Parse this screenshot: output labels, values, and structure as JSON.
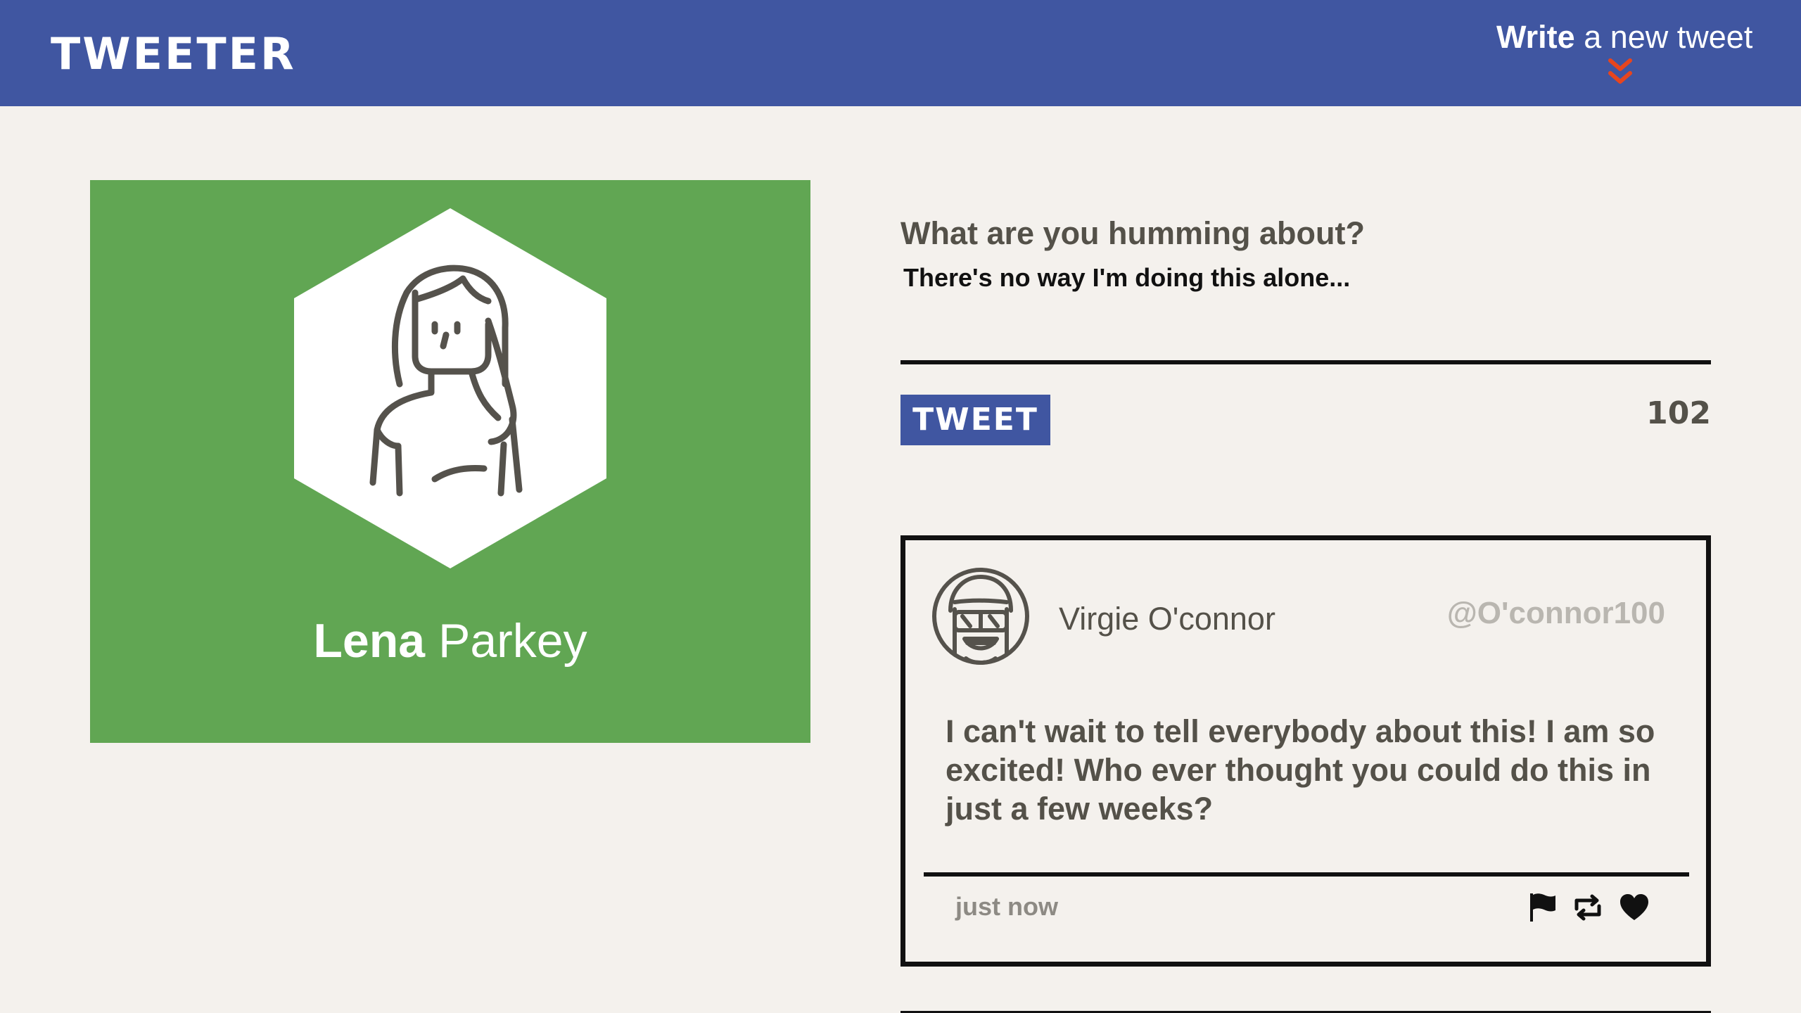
{
  "header": {
    "logo": "TWEETER",
    "compose_toggle": {
      "bold": "Write",
      "rest": " a new tweet"
    }
  },
  "profile": {
    "first_name": "Lena",
    "last_name": "Parkey",
    "card_color": "#61a653",
    "avatar_icon": "woman-avatar-icon"
  },
  "compose": {
    "label": "What are you humming about?",
    "text": "There's no way I'm doing this alone...",
    "button_label": "TWEET",
    "char_counter": "102"
  },
  "tweets": [
    {
      "name": "Virgie O'connor",
      "handle": "@O'connor100",
      "avatar_icon": "sunglasses-avatar-icon",
      "body": "I can't wait to tell everybody about this! I am so excited! Who ever thought you could do this in just a few weeks?",
      "time": "just now",
      "actions": [
        "flag-icon",
        "retweet-icon",
        "heart-icon"
      ]
    }
  ],
  "colors": {
    "nav": "#4056a1",
    "accent": "#e8451e",
    "background": "#f4f1ed",
    "text": "#545149"
  }
}
